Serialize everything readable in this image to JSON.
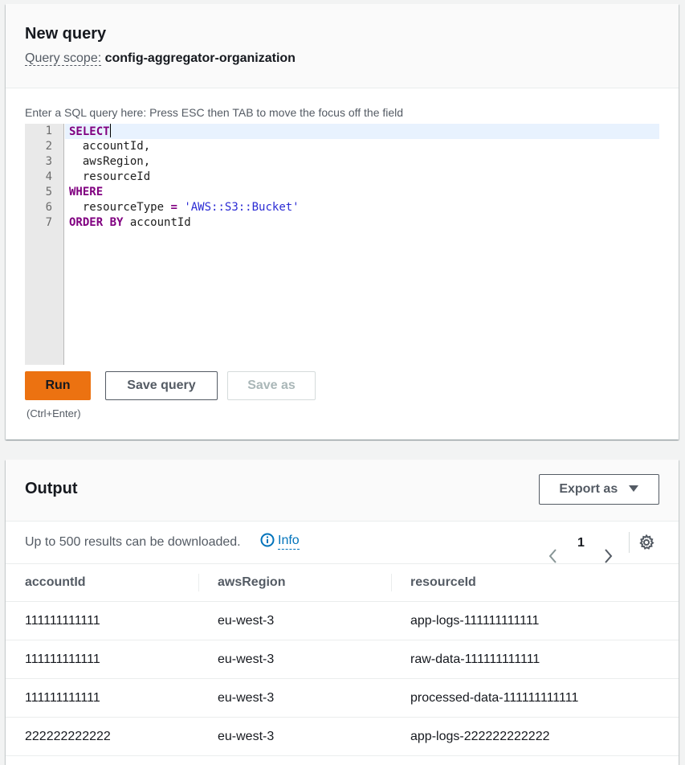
{
  "query": {
    "title": "New query",
    "scope_label": "Query scope:",
    "scope_value": "config-aggregator-organization",
    "editor_hint": "Enter a SQL query here: Press ESC then TAB to move the focus off the field",
    "lines": [
      {
        "num": "1"
      },
      {
        "num": "2"
      },
      {
        "num": "3"
      },
      {
        "num": "4"
      },
      {
        "num": "5"
      },
      {
        "num": "6"
      },
      {
        "num": "7"
      }
    ],
    "code": {
      "l1_kw": "SELECT",
      "l2": "  accountId,",
      "l3": "  awsRegion,",
      "l4": "  resourceId",
      "l5_kw": "WHERE",
      "l6_a": "  resourceType ",
      "l6_op": "=",
      "l6_str": "'AWS::S3::Bucket'",
      "l7_kw": "ORDER BY",
      "l7_b": " accountId"
    },
    "run_label": "Run",
    "save_label": "Save query",
    "saveas_label": "Save as",
    "shortcut": "(Ctrl+Enter)"
  },
  "output": {
    "title": "Output",
    "export_label": "Export as",
    "note": "Up to 500 results can be downloaded.",
    "info_label": "Info",
    "page": "1",
    "columns": [
      "accountId",
      "awsRegion",
      "resourceId"
    ],
    "rows": [
      [
        "111111111111",
        "eu-west-3",
        "app-logs-111111111111"
      ],
      [
        "111111111111",
        "eu-west-3",
        "raw-data-111111111111"
      ],
      [
        "111111111111",
        "eu-west-3",
        "processed-data-111111111111"
      ],
      [
        "222222222222",
        "eu-west-3",
        "app-logs-222222222222"
      ]
    ]
  },
  "colors": {
    "accent": "#ec7211",
    "link": "#0073bb",
    "keyword": "#800080",
    "string": "#2b2bd4"
  }
}
